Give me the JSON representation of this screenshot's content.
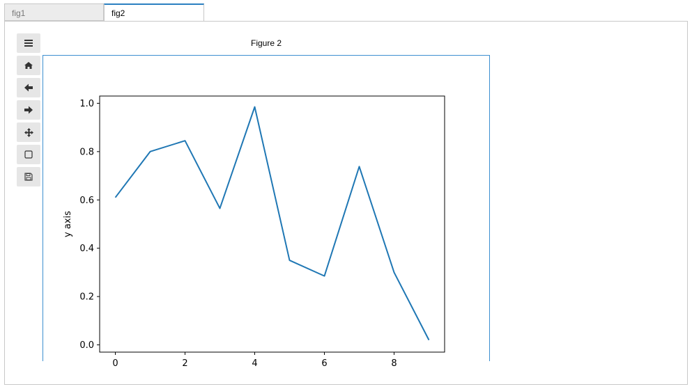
{
  "tabs": [
    {
      "label": "fig1",
      "active": false
    },
    {
      "label": "fig2",
      "active": true
    }
  ],
  "toolbar": {
    "buttons": [
      {
        "name": "menu-icon"
      },
      {
        "name": "home-icon"
      },
      {
        "name": "back-arrow-icon"
      },
      {
        "name": "forward-arrow-icon"
      },
      {
        "name": "pan-icon"
      },
      {
        "name": "zoom-rect-icon"
      },
      {
        "name": "save-icon"
      }
    ]
  },
  "figure": {
    "title": "Figure 2"
  },
  "colors": {
    "line": "#1f77b4",
    "accent": "#2a7fc1"
  },
  "chart_data": {
    "type": "line",
    "x": [
      0,
      1,
      2,
      3,
      4,
      5,
      6,
      7,
      8,
      9
    ],
    "series": [
      {
        "values": [
          0.61,
          0.8,
          0.845,
          0.565,
          0.985,
          0.35,
          0.285,
          0.738,
          0.3,
          0.02
        ]
      }
    ],
    "xlabel": "",
    "ylabel": "y axis",
    "xticks": [
      "0",
      "2",
      "4",
      "6",
      "8"
    ],
    "yticks": [
      "0.0",
      "0.2",
      "0.4",
      "0.6",
      "0.8",
      "1.0"
    ],
    "xlim": [
      -0.45,
      9.45
    ],
    "ylim": [
      -0.03,
      1.03
    ],
    "grid": false
  }
}
